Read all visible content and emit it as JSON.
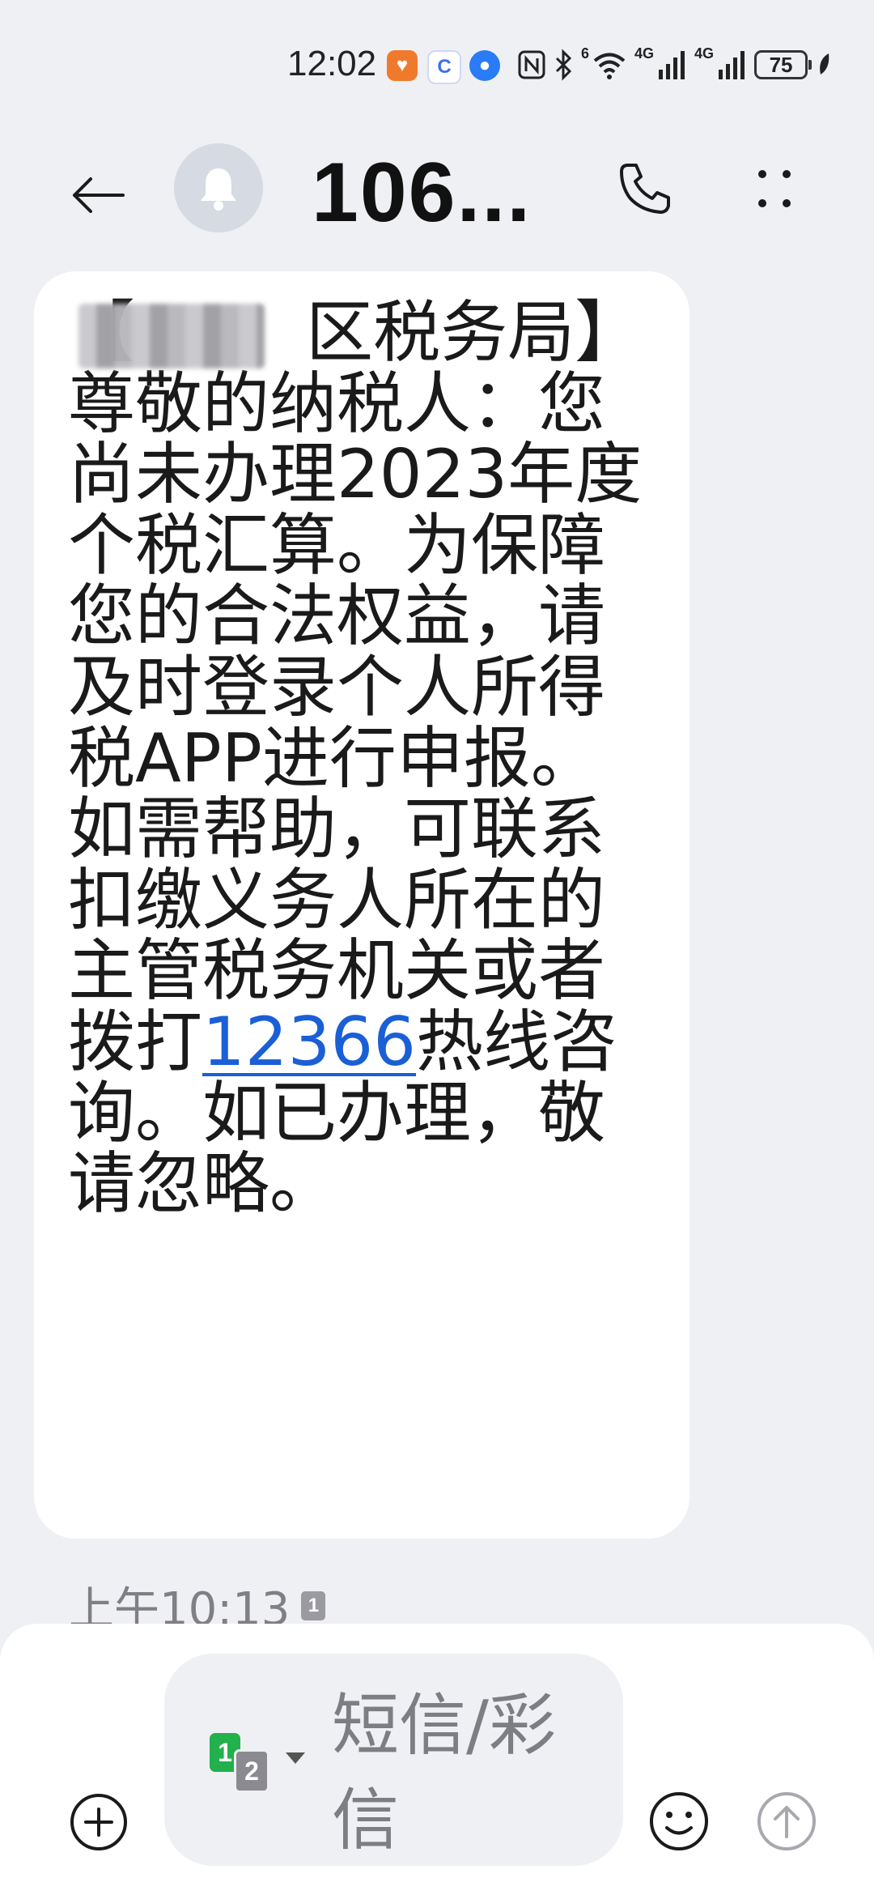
{
  "status_bar": {
    "time": "12:02",
    "network_1": "4G",
    "network_2": "4G",
    "wifi_badge": "6",
    "battery": "75",
    "apps": [
      {
        "name": "health-app-icon",
        "color": "#f07a2b",
        "glyph": "♥"
      },
      {
        "name": "browser-app-icon",
        "color": "#3a6ff0",
        "glyph": "C"
      },
      {
        "name": "globe-app-icon",
        "color": "#2a7bf6",
        "glyph": "●"
      }
    ]
  },
  "header": {
    "contact_name": "106...",
    "back_icon": "arrow-left-icon",
    "avatar_icon": "bell-icon",
    "call_icon": "phone-icon",
    "more_icon": "more-vertical-icon"
  },
  "message": {
    "text_before_number": "【        区税务局】尊敬的纳税人：您尚未办理2023年度个税汇算。为保障您的合法权益，请及时登录个人所得税APP进行申报。如需帮助，可联系扣缴义务人所在的主管税务机关或者拨打",
    "phone_number": "12366",
    "text_after_number": "热线咨询。如已办理，敬请忽略。",
    "time": "上午10:13",
    "sim_label": "1",
    "link_color": "#1a5fd6"
  },
  "composer": {
    "placeholder": "短信/彩信",
    "sim1_label": "1",
    "sim2_label": "2",
    "attach_icon": "plus-circle-icon",
    "emoji_icon": "smiley-icon",
    "send_icon": "send-up-arrow-icon"
  }
}
